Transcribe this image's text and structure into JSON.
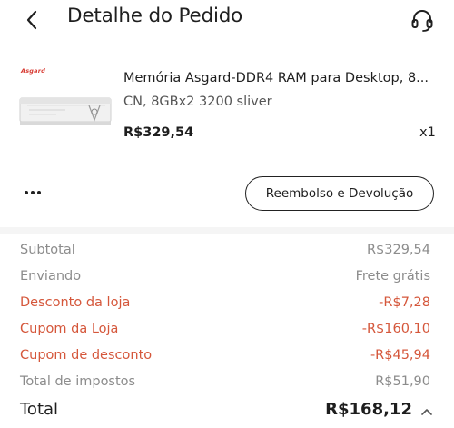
{
  "header": {
    "title": "Detalhe do Pedido"
  },
  "product": {
    "brand": "Asgard",
    "name": "Memória Asgard-DDR4 RAM para Desktop, 8...",
    "variant": "CN, 8GBx2 3200 sliver",
    "price": "R$329,54",
    "quantity": "x1"
  },
  "actions": {
    "more_label": "•••",
    "refund_label": "Reembolso e Devolução"
  },
  "summary": {
    "rows": [
      {
        "label": "Subtotal",
        "value": "R$329,54"
      },
      {
        "label": "Enviando",
        "value": "Frete grátis"
      },
      {
        "label": "Desconto da loja",
        "value": "-R$7,28"
      },
      {
        "label": "Cupom da Loja",
        "value": "-R$160,10"
      },
      {
        "label": "Cupom de desconto",
        "value": "-R$45,94"
      },
      {
        "label": "Total de impostos",
        "value": "R$51,90"
      }
    ],
    "total_label": "Total",
    "total_value": "R$168,12"
  },
  "colors": {
    "discount": "#d5573b",
    "muted": "#8c8c8c",
    "text": "#1e1e1e"
  }
}
